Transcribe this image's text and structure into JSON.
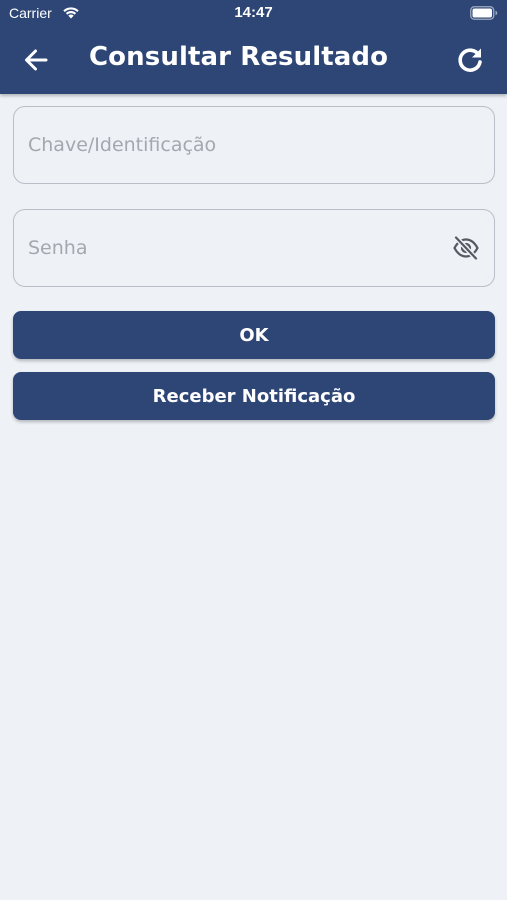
{
  "status_bar": {
    "carrier": "Carrier",
    "time": "14:47",
    "wifi_icon": "wifi-icon",
    "battery_icon": "battery-icon"
  },
  "header": {
    "title": "Consultar Resultado",
    "back_icon": "arrow-left-icon",
    "refresh_icon": "refresh-icon"
  },
  "form": {
    "key_field": {
      "value": "",
      "placeholder": "Chave/Identificação"
    },
    "password_field": {
      "value": "",
      "placeholder": "Senha",
      "visibility_icon": "eye-off-icon"
    }
  },
  "buttons": {
    "ok_label": "OK",
    "notify_label": "Receber Notificação"
  },
  "colors": {
    "primary": "#2e4676",
    "background": "#eef2f7",
    "field_border": "#b9bfc8",
    "placeholder": "#a3a8b0"
  }
}
